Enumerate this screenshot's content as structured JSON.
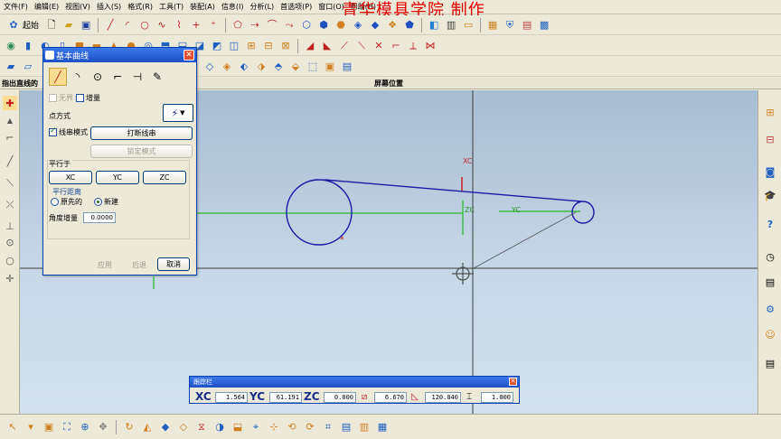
{
  "menu": [
    "文件(F)",
    "编辑(E)",
    "视图(V)",
    "插入(S)",
    "格式(R)",
    "工具(T)",
    "装配(A)",
    "信息(I)",
    "分析(L)",
    "首选项(P)",
    "窗口(O)",
    "帮助(H)"
  ],
  "watermark": "青华模具学院 制作",
  "start_label": "起始",
  "prompt": "指出直线的",
  "status": "屏幕位置",
  "dialog": {
    "title": "基本曲线",
    "unbounded": "无界",
    "incremental": "增量",
    "point_method": "点方式",
    "string_mode": "线串模式",
    "break_string": "打断线串",
    "lock_mode": "锁定模式",
    "parallel_to": "平行于",
    "xc": "XC",
    "yc": "YC",
    "zc": "ZC",
    "parallel_distance": "平行距离",
    "original": "原先的",
    "new": "新建",
    "angle_increment": "角度增量",
    "angle_value": "0.0000",
    "apply": "应用",
    "back": "后退",
    "cancel": "取消"
  },
  "tracker": {
    "title": "跟踪栏",
    "xc_label": "XC",
    "xc_value": "1.564",
    "yc_label": "YC",
    "yc_value": "61.191",
    "zc_label": "ZC",
    "zc_value": "0.000",
    "length_value": "6.670",
    "angle_value": "120.040",
    "offset_value": "1.000"
  },
  "canvas_labels": {
    "xc": "XC",
    "zc": "ZC",
    "yc": "YC"
  },
  "colors": {
    "curve": "#1a1aa8",
    "axis_green": "#22bb22",
    "axis_red": "#cc2020",
    "crosshair": "#505050"
  },
  "icons": {
    "curve_tools": [
      "line-icon",
      "arc-icon",
      "circle-icon",
      "fillet-icon",
      "trim-icon",
      "edit-parameter-icon"
    ]
  }
}
